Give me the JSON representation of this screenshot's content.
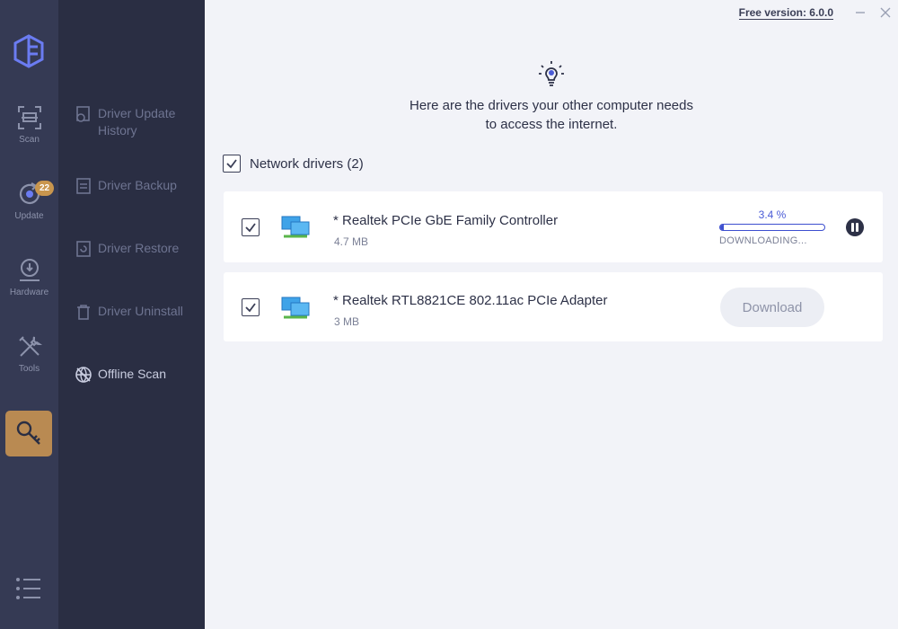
{
  "rail": {
    "items": [
      {
        "label": "Scan",
        "icon": "scan-icon"
      },
      {
        "label": "Update",
        "icon": "update-icon",
        "badge": "22"
      },
      {
        "label": "Hardware",
        "icon": "hardware-icon"
      },
      {
        "label": "Tools",
        "icon": "tools-icon"
      }
    ],
    "active_icon": "key-icon",
    "bottom_icon": "menu-list-icon",
    "accent_color": "#b98a52"
  },
  "submenu": {
    "items": [
      {
        "label": "Driver Update History"
      },
      {
        "label": "Driver Backup"
      },
      {
        "label": "Driver Restore"
      },
      {
        "label": "Driver Uninstall"
      },
      {
        "label": "Offline Scan"
      }
    ],
    "active": "Offline Scan"
  },
  "topbar": {
    "version": "Free version: 6.0.0"
  },
  "main": {
    "headline_line1": "Here are the drivers your other computer needs",
    "headline_line2": "to access the internet.",
    "section_title": "Network drivers (2)",
    "drivers": [
      {
        "name": "* Realtek PCIe GbE Family Controller",
        "size": "4.7 MB",
        "checked": true,
        "progress_label": "3.4 %",
        "progress": 0.034,
        "status": "DOWNLOADING..."
      },
      {
        "name": "* Realtek RTL8821CE 802.11ac PCIe Adapter",
        "size": "3 MB",
        "checked": true,
        "button": "Download"
      }
    ]
  },
  "colors": {
    "progress": "#3d4fcf",
    "rail_bg": "#353a54",
    "submenu_bg": "#2a2e43"
  }
}
